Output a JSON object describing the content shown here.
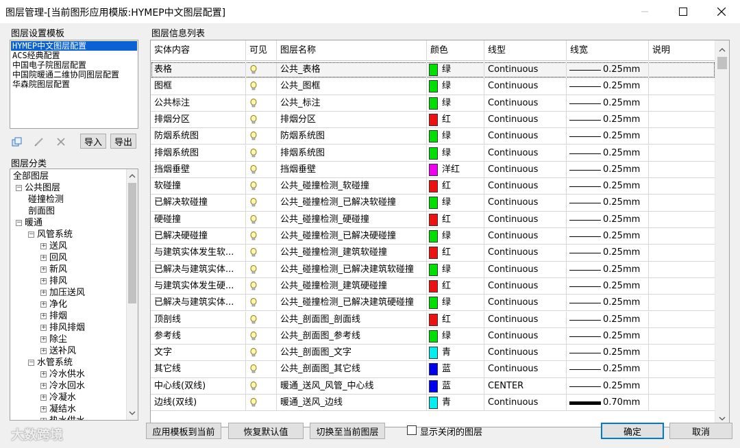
{
  "window": {
    "title": "图层管理-[当前图形应用模版:HYMEP中文图层配置]"
  },
  "templates": {
    "group_label": "图层设置模板",
    "items": [
      "HYMEP中文图层配置",
      "ACS经典配置",
      "中国电子院图层配置",
      "中国院暖通二维协同图层配置",
      "华森院图层配置"
    ],
    "selected_index": 0,
    "import_label": "导入",
    "export_label": "导出",
    "icons": [
      "copy-icon",
      "edit-icon",
      "delete-icon"
    ]
  },
  "category": {
    "group_label": "图层分类",
    "tree": [
      {
        "label": "全部图层",
        "level": 0,
        "expander": ""
      },
      {
        "label": "公共图层",
        "level": 1,
        "expander": "-"
      },
      {
        "label": "碰撞检测",
        "level": 2,
        "expander": ""
      },
      {
        "label": "剖面图",
        "level": 2,
        "expander": ""
      },
      {
        "label": "暖通",
        "level": 1,
        "expander": "-"
      },
      {
        "label": "风管系统",
        "level": 2,
        "expander": "-"
      },
      {
        "label": "送风",
        "level": 3,
        "expander": "+"
      },
      {
        "label": "回风",
        "level": 3,
        "expander": "+"
      },
      {
        "label": "新风",
        "level": 3,
        "expander": "+"
      },
      {
        "label": "排风",
        "level": 3,
        "expander": "+"
      },
      {
        "label": "加压送风",
        "level": 3,
        "expander": "+"
      },
      {
        "label": "净化",
        "level": 3,
        "expander": "+"
      },
      {
        "label": "排烟",
        "level": 3,
        "expander": "+"
      },
      {
        "label": "排风排烟",
        "level": 3,
        "expander": "+"
      },
      {
        "label": "除尘",
        "level": 3,
        "expander": "+"
      },
      {
        "label": "送补风",
        "level": 3,
        "expander": "+"
      },
      {
        "label": "水管系统",
        "level": 2,
        "expander": "-"
      },
      {
        "label": "冷水供水",
        "level": 3,
        "expander": "+"
      },
      {
        "label": "冷水回水",
        "level": 3,
        "expander": "+"
      },
      {
        "label": "冷凝水",
        "level": 3,
        "expander": "+"
      },
      {
        "label": "凝结水",
        "level": 3,
        "expander": "+"
      },
      {
        "label": "热水供水",
        "level": 3,
        "expander": "+"
      }
    ]
  },
  "table": {
    "group_label": "图层信息列表",
    "columns": [
      "实体内容",
      "可见",
      "图层名称",
      "颜色",
      "线型",
      "线宽",
      "说明"
    ],
    "rows": [
      {
        "entity": "表格",
        "visible_icon": "bulb-icon",
        "layer": "公共_表格",
        "color_name": "绿",
        "color_hex": "#00e000",
        "linetype": "Continuous",
        "lineweight": "0.25mm",
        "note": ""
      },
      {
        "entity": "图框",
        "visible_icon": "bulb-icon",
        "layer": "公共_图框",
        "color_name": "绿",
        "color_hex": "#00e000",
        "linetype": "Continuous",
        "lineweight": "0.25mm",
        "note": ""
      },
      {
        "entity": "公共标注",
        "visible_icon": "bulb-icon",
        "layer": "公共_标注",
        "color_name": "绿",
        "color_hex": "#00e000",
        "linetype": "Continuous",
        "lineweight": "0.25mm",
        "note": ""
      },
      {
        "entity": "排烟分区",
        "visible_icon": "bulb-icon",
        "layer": "排烟分区",
        "color_name": "红",
        "color_hex": "#ee1111",
        "linetype": "Continuous",
        "lineweight": "0.25mm",
        "note": ""
      },
      {
        "entity": "防烟系统图",
        "visible_icon": "bulb-icon",
        "layer": "防烟系统图",
        "color_name": "绿",
        "color_hex": "#00e000",
        "linetype": "Continuous",
        "lineweight": "0.25mm",
        "note": ""
      },
      {
        "entity": "排烟系统图",
        "visible_icon": "bulb-icon",
        "layer": "排烟系统图",
        "color_name": "绿",
        "color_hex": "#00e000",
        "linetype": "Continuous",
        "lineweight": "0.25mm",
        "note": ""
      },
      {
        "entity": "挡烟垂壁",
        "visible_icon": "bulb-icon",
        "layer": "挡烟垂壁",
        "color_name": "洋红",
        "color_hex": "#ee00ee",
        "linetype": "Continuous",
        "lineweight": "0.25mm",
        "note": ""
      },
      {
        "entity": "软碰撞",
        "visible_icon": "bulb-icon",
        "layer": "公共_碰撞检测_软碰撞",
        "color_name": "红",
        "color_hex": "#ee1111",
        "linetype": "Continuous",
        "lineweight": "0.25mm",
        "note": ""
      },
      {
        "entity": "已解决软碰撞",
        "visible_icon": "bulb-icon",
        "layer": "公共_碰撞检测_已解决软碰撞",
        "color_name": "绿",
        "color_hex": "#00e000",
        "linetype": "Continuous",
        "lineweight": "0.25mm",
        "note": ""
      },
      {
        "entity": "硬碰撞",
        "visible_icon": "bulb-icon",
        "layer": "公共_碰撞检测_硬碰撞",
        "color_name": "红",
        "color_hex": "#ee1111",
        "linetype": "Continuous",
        "lineweight": "0.25mm",
        "note": ""
      },
      {
        "entity": "已解决硬碰撞",
        "visible_icon": "bulb-icon",
        "layer": "公共_碰撞检测_已解决硬碰撞",
        "color_name": "绿",
        "color_hex": "#00e000",
        "linetype": "Continuous",
        "lineweight": "0.25mm",
        "note": ""
      },
      {
        "entity": "与建筑实体发生软...",
        "visible_icon": "bulb-icon",
        "layer": "公共_碰撞检测_建筑软碰撞",
        "color_name": "红",
        "color_hex": "#ee1111",
        "linetype": "Continuous",
        "lineweight": "0.25mm",
        "note": ""
      },
      {
        "entity": "已解决与建筑实体...",
        "visible_icon": "bulb-icon",
        "layer": "公共_碰撞检测_已解决建筑软碰撞",
        "color_name": "绿",
        "color_hex": "#00e000",
        "linetype": "Continuous",
        "lineweight": "0.25mm",
        "note": ""
      },
      {
        "entity": "与建筑实体发生硬...",
        "visible_icon": "bulb-icon",
        "layer": "公共_碰撞检测_建筑硬碰撞",
        "color_name": "红",
        "color_hex": "#ee1111",
        "linetype": "Continuous",
        "lineweight": "0.25mm",
        "note": ""
      },
      {
        "entity": "已解决与建筑实体...",
        "visible_icon": "bulb-icon",
        "layer": "公共_碰撞检测_已解决建筑硬碰撞",
        "color_name": "绿",
        "color_hex": "#00e000",
        "linetype": "Continuous",
        "lineweight": "0.25mm",
        "note": ""
      },
      {
        "entity": "顶剖线",
        "visible_icon": "bulb-icon",
        "layer": "公共_剖面图_剖面线",
        "color_name": "红",
        "color_hex": "#ee1111",
        "linetype": "Continuous",
        "lineweight": "0.25mm",
        "note": ""
      },
      {
        "entity": "参考线",
        "visible_icon": "bulb-icon",
        "layer": "公共_剖面图_参考线",
        "color_name": "绿",
        "color_hex": "#00e000",
        "linetype": "Continuous",
        "lineweight": "0.25mm",
        "note": ""
      },
      {
        "entity": "文字",
        "visible_icon": "bulb-icon",
        "layer": "公共_剖面图_文字",
        "color_name": "青",
        "color_hex": "#00eeee",
        "linetype": "Continuous",
        "lineweight": "0.25mm",
        "note": ""
      },
      {
        "entity": "其它线",
        "visible_icon": "bulb-icon",
        "layer": "公共_剖面图_其它线",
        "color_name": "蓝",
        "color_hex": "#0000ee",
        "linetype": "Continuous",
        "lineweight": "0.25mm",
        "note": ""
      },
      {
        "entity": "中心线(双线)",
        "visible_icon": "bulb-icon",
        "layer": "暖通_送风_风管_中心线",
        "color_name": "蓝",
        "color_hex": "#0000ee",
        "linetype": "CENTER",
        "lineweight": "0.25mm",
        "note": ""
      },
      {
        "entity": "边线(双线)",
        "visible_icon": "bulb-icon",
        "layer": "暖通_送风_边线",
        "color_name": "青",
        "color_hex": "#00eeee",
        "linetype": "Continuous",
        "lineweight": "0.70mm",
        "note": ""
      }
    ],
    "selected_row": 0
  },
  "footer": {
    "apply_template": "应用模板到当前",
    "restore_default": "恢复默认值",
    "switch_current": "切换至当前图层",
    "show_closed": "显示关闭的图层",
    "show_closed_checked": false,
    "ok": "确定",
    "cancel": "取消"
  },
  "watermark": "大数跨境"
}
